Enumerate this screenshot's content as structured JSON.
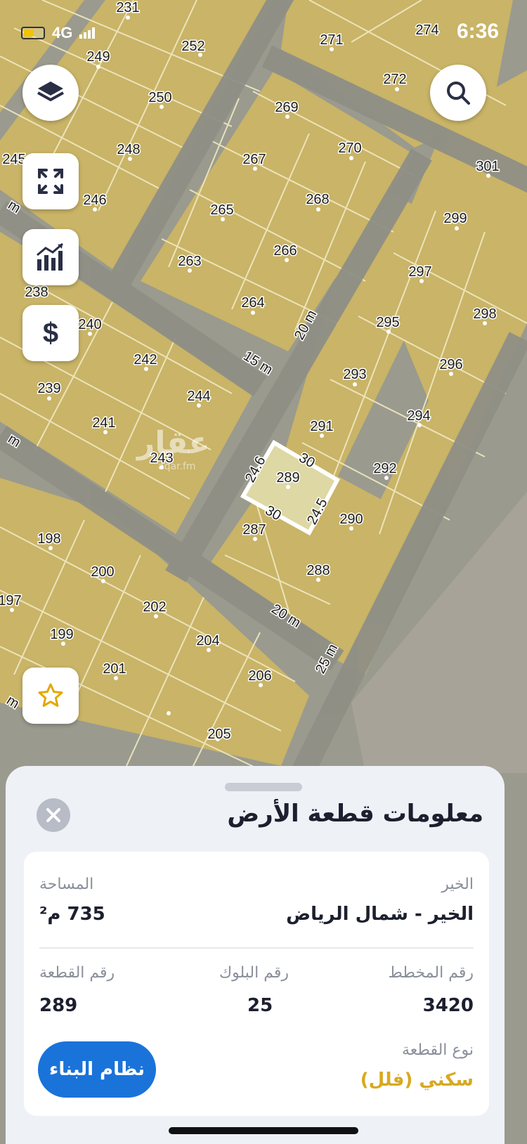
{
  "status": {
    "network": "4G",
    "time": "6:36"
  },
  "map": {
    "road_labels": [
      "20 m",
      "15 m",
      "20 m",
      "25 m",
      "m",
      "m",
      "m"
    ],
    "parcels": [
      "231",
      "252",
      "249",
      "250",
      "248",
      "245",
      "246",
      "271",
      "272",
      "274",
      "269",
      "270",
      "267",
      "268",
      "265",
      "266",
      "263",
      "264",
      "301",
      "299",
      "297",
      "298",
      "295",
      "296",
      "293",
      "294",
      "291",
      "292",
      "290",
      "289",
      "287",
      "288",
      "240",
      "238",
      "239",
      "241",
      "242",
      "244",
      "243",
      "198",
      "200",
      "197",
      "202",
      "199",
      "204",
      "201",
      "206",
      "205"
    ],
    "selected_edges": [
      "24.6",
      "30",
      "30",
      "24.5"
    ],
    "watermark": "عقار",
    "watermark_sub": "aqar.fm"
  },
  "icons": {
    "layers": "layers-icon",
    "search": "search-icon",
    "expand": "expand-icon",
    "chart": "chart-icon",
    "price": "dollar-icon",
    "favorite": "star-icon",
    "close": "close-icon"
  },
  "price_symbol": "$",
  "sheet": {
    "title": "معلومات قطعة الأرض",
    "district_label": "الخير",
    "district_value": "الخير - شمال الرياض",
    "area_label": "المساحة",
    "area_value": "735 م²",
    "plan_label": "رقم المخطط",
    "plan_value": "3420",
    "block_label": "رقم البلوك",
    "block_value": "25",
    "plot_label": "رقم القطعة",
    "plot_value": "289",
    "type_label": "نوع القطعة",
    "type_value": "سكني (فلل)",
    "build_button": "نظام البناء"
  },
  "colors": {
    "parcel": "#c9b467",
    "road": "#8a8a80",
    "accent": "#1a73d9",
    "type": "#d8a91f"
  }
}
